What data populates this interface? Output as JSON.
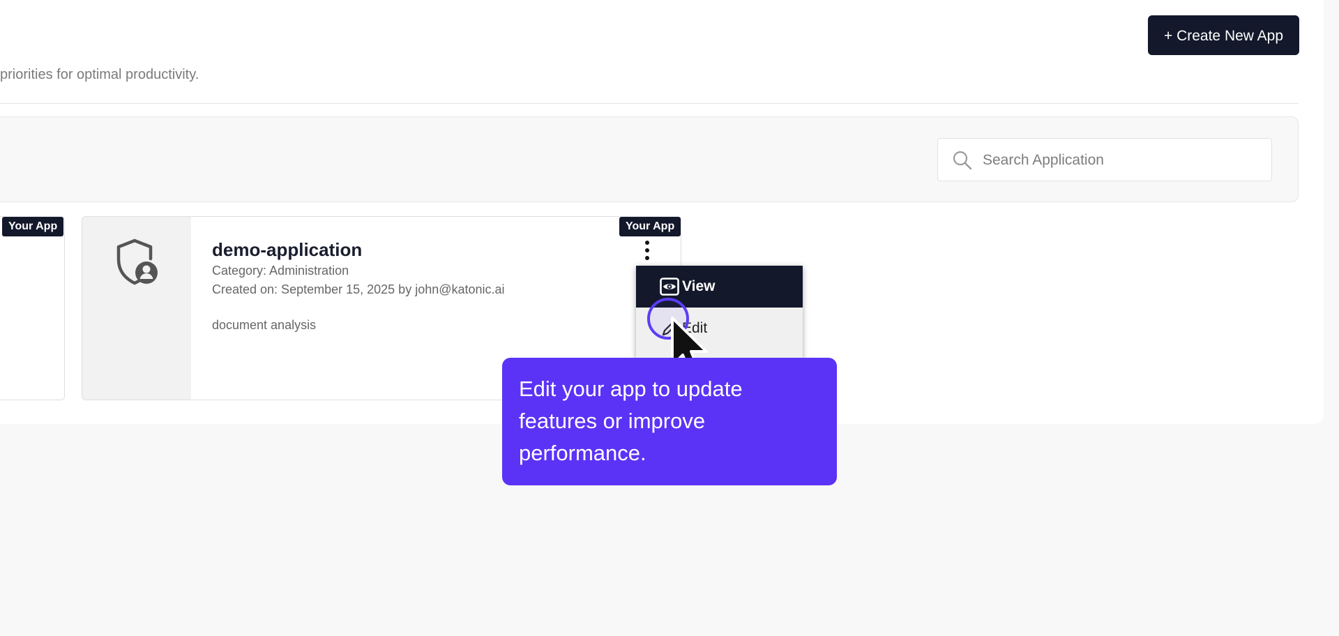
{
  "header": {
    "create_button_label": "+ Create New App",
    "subtitle": "priorities for optimal productivity."
  },
  "search": {
    "placeholder": "Search Application",
    "value": "",
    "icon": "search-icon"
  },
  "cards": [
    {
      "badge": "Your App"
    },
    {
      "badge": "Your App",
      "icon": "shield-user-icon",
      "title": "demo-application",
      "category": "Category: Administration",
      "created": "Created on: September 15, 2025 by john@katonic.ai",
      "description": "document analysis"
    }
  ],
  "context_menu": {
    "items": [
      {
        "label": "View",
        "icon": "eye-icon"
      },
      {
        "label": "Edit",
        "icon": "pencil-icon"
      }
    ]
  },
  "tooltip": {
    "text": "Edit your app to update features or improve performance."
  },
  "colors": {
    "primary_dark": "#13182b",
    "tooltip_purple": "#5b33f6",
    "page_background": "#f8f8f8"
  }
}
